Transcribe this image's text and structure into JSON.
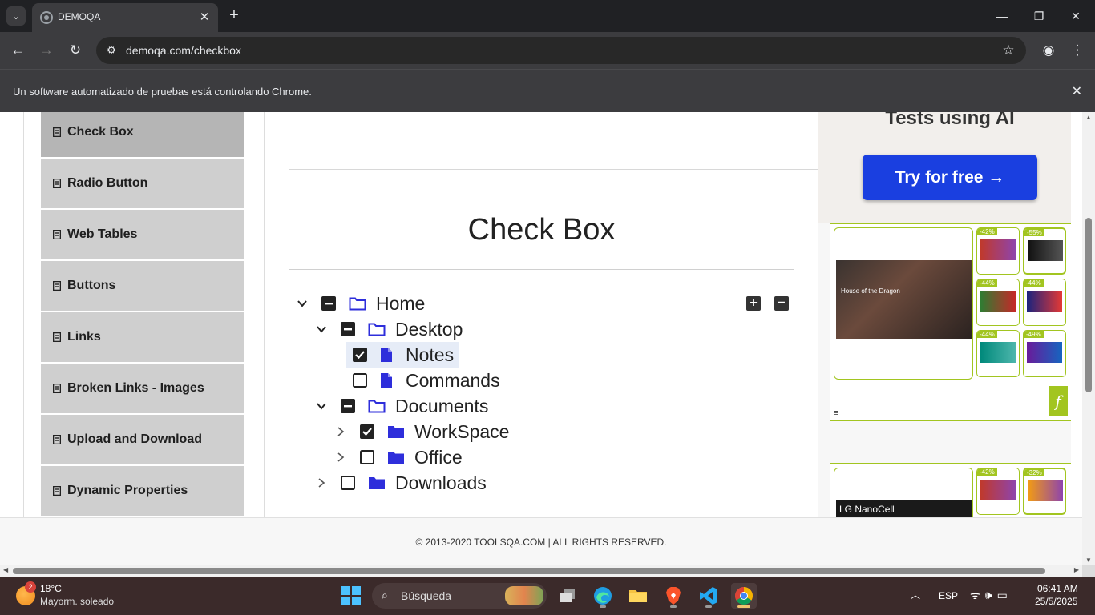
{
  "browser": {
    "tab_title": "DEMOQA",
    "url": "demoqa.com/checkbox",
    "infobar_text": "Un software automatizado de pruebas está controlando Chrome."
  },
  "sidebar": {
    "items": [
      {
        "label": "Check Box",
        "active": true
      },
      {
        "label": "Radio Button"
      },
      {
        "label": "Web Tables"
      },
      {
        "label": "Buttons"
      },
      {
        "label": "Links"
      },
      {
        "label": "Broken Links - Images"
      },
      {
        "label": "Upload and Download"
      },
      {
        "label": "Dynamic Properties"
      }
    ]
  },
  "main": {
    "title": "Check Box",
    "tree": [
      {
        "label": "Home",
        "state": "partial",
        "expanded": true,
        "type": "folder-open"
      },
      {
        "label": "Desktop",
        "state": "partial",
        "expanded": true,
        "type": "folder-open"
      },
      {
        "label": "Notes",
        "state": "checked",
        "type": "file"
      },
      {
        "label": "Commands",
        "state": "unchecked",
        "type": "file"
      },
      {
        "label": "Documents",
        "state": "partial",
        "expanded": true,
        "type": "folder-open"
      },
      {
        "label": "WorkSpace",
        "state": "checked",
        "expanded": false,
        "type": "folder"
      },
      {
        "label": "Office",
        "state": "unchecked",
        "expanded": false,
        "type": "folder"
      },
      {
        "label": "Downloads",
        "state": "unchecked",
        "expanded": false,
        "type": "folder"
      }
    ]
  },
  "ads": {
    "headline": "Tests using AI",
    "cta": "Try for free →",
    "banner1": {
      "tv_title": "House of the Dragon",
      "discounts": [
        "-42%",
        "-55%",
        "-44%",
        "-44%",
        "-44%",
        "-49%"
      ],
      "menu": "≡",
      "logo": "f"
    },
    "banner2": {
      "tv_brand": "LG NanoCell",
      "discounts": [
        "-42%",
        "-32%"
      ]
    }
  },
  "footer": {
    "text": "© 2013-2020 TOOLSQA.COM | ALL RIGHTS RESERVED."
  },
  "taskbar": {
    "weather_badge": "2",
    "weather_temp": "18°C",
    "weather_desc": "Mayorm. soleado",
    "search_text": "Búsqueda",
    "lang": "ESP",
    "time": "06:41 AM",
    "date": "25/5/2025"
  },
  "colors": {
    "accent_blue": "#1a3fe0",
    "folder_blue": "#2e2edb",
    "ad_green": "#a2c520"
  }
}
